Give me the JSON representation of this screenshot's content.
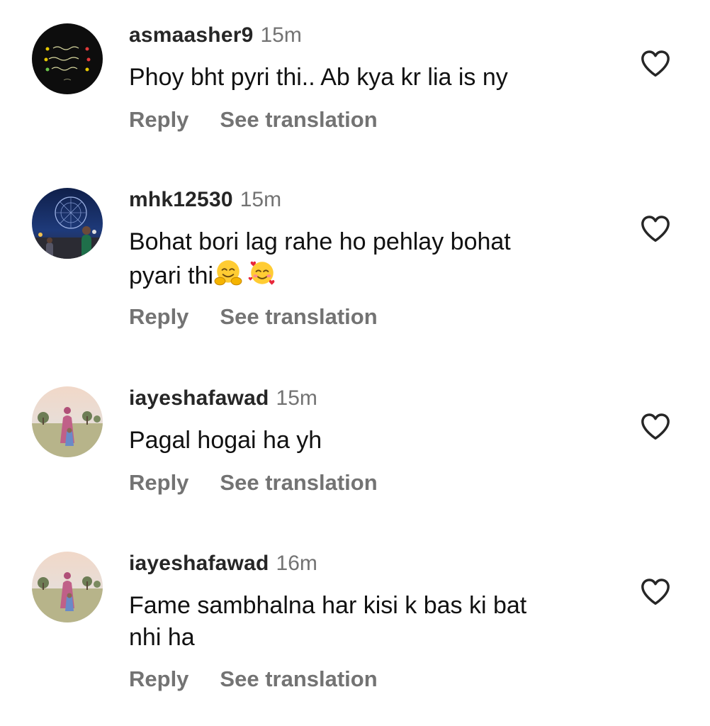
{
  "comments": [
    {
      "username": "asmaasher9",
      "time": "15m",
      "text": "Phoy bht pyri thi.. Ab kya kr lia is ny",
      "text_lines": [
        "Phoy bht pyri thi.. Ab kya kr lia is ny"
      ],
      "reply_label": "Reply",
      "translate_label": "See translation",
      "avatar_icon": "urdu-poetry-avatar-icon"
    },
    {
      "username": "mhk12530",
      "time": "15m",
      "text_lines": [
        "Bohat bori lag rahe ho pehlay bohat",
        "pyari thi"
      ],
      "emojis": [
        "🤗",
        "🥰"
      ],
      "reply_label": "Reply",
      "translate_label": "See translation",
      "avatar_icon": "ferris-wheel-photo-avatar-icon"
    },
    {
      "username": "iayeshafawad",
      "time": "15m",
      "text_lines": [
        "Pagal hogai ha yh"
      ],
      "reply_label": "Reply",
      "translate_label": "See translation",
      "avatar_icon": "park-photo-avatar-icon"
    },
    {
      "username": "iayeshafawad",
      "time": "16m",
      "text_lines": [
        "Fame sambhalna har kisi k bas ki bat",
        "nhi ha"
      ],
      "reply_label": "Reply",
      "translate_label": "See translation",
      "avatar_icon": "park-photo-avatar-icon"
    }
  ],
  "colors": {
    "username": "#262626",
    "secondary_text": "#737373",
    "body_text": "#111111",
    "heart_outline": "#262626"
  },
  "icons": [
    "heart-outline-icon",
    "hugging-face-emoji",
    "smiling-face-with-hearts-emoji"
  ]
}
